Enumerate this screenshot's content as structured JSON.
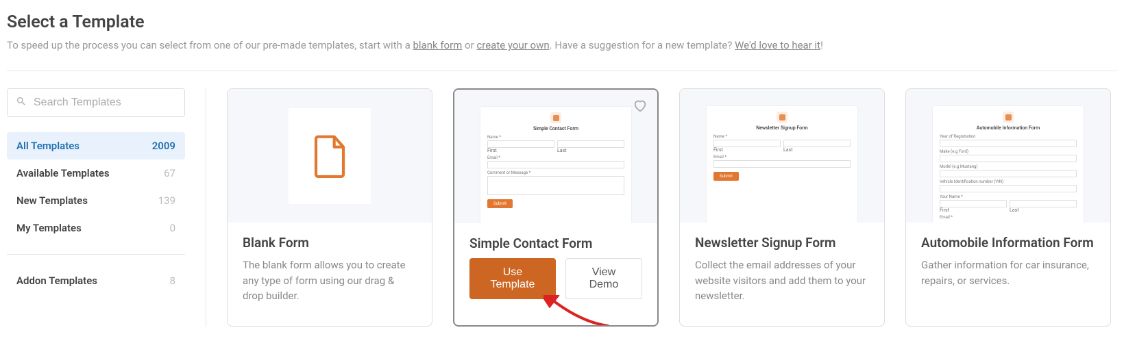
{
  "title": "Select a Template",
  "intro": {
    "prefix": "To speed up the process you can select from one of our pre-made templates, start with a ",
    "link1": "blank form",
    "mid": " or ",
    "link2": "create your own",
    "suffix1": ". Have a suggestion for a new template? ",
    "link3": "We'd love to hear it",
    "suffix2": "!"
  },
  "search": {
    "placeholder": "Search Templates"
  },
  "filters": [
    {
      "label": "All Templates",
      "count": "2009",
      "active": true
    },
    {
      "label": "Available Templates",
      "count": "67",
      "active": false
    },
    {
      "label": "New Templates",
      "count": "139",
      "active": false
    },
    {
      "label": "My Templates",
      "count": "0",
      "active": false
    }
  ],
  "addon": {
    "label": "Addon Templates",
    "count": "8"
  },
  "cards": {
    "blank": {
      "title": "Blank Form",
      "desc": "The blank form allows you to create any type of form using our drag & drop builder."
    },
    "contact": {
      "title": "Simple Contact Form",
      "preview_title": "Simple Contact Form",
      "use": "Use Template",
      "demo": "View Demo",
      "labels": {
        "name": "Name *",
        "first": "First",
        "last": "Last",
        "email": "Email *",
        "msg": "Comment or Message *",
        "submit": "Submit"
      }
    },
    "newsletter": {
      "title": "Newsletter Signup Form",
      "preview_title": "Newsletter Signup Form",
      "desc": "Collect the email addresses of your website visitors and add them to your newsletter.",
      "labels": {
        "name": "Name *",
        "first": "First",
        "last": "Last",
        "email": "Email *",
        "submit": "Submit"
      }
    },
    "auto": {
      "title": "Automobile Information Form",
      "preview_title": "Automobile Information Form",
      "desc": "Gather information for car insurance, repairs, or services.",
      "labels": {
        "yor": "Year of Registration",
        "make": "Make (e.g Ford)",
        "model": "Model (e.g Mustang)",
        "vin": "Vehicle Identification number (VIN)",
        "yname": "Your Name *",
        "first": "First",
        "last": "Last",
        "email": "Email *"
      }
    }
  }
}
